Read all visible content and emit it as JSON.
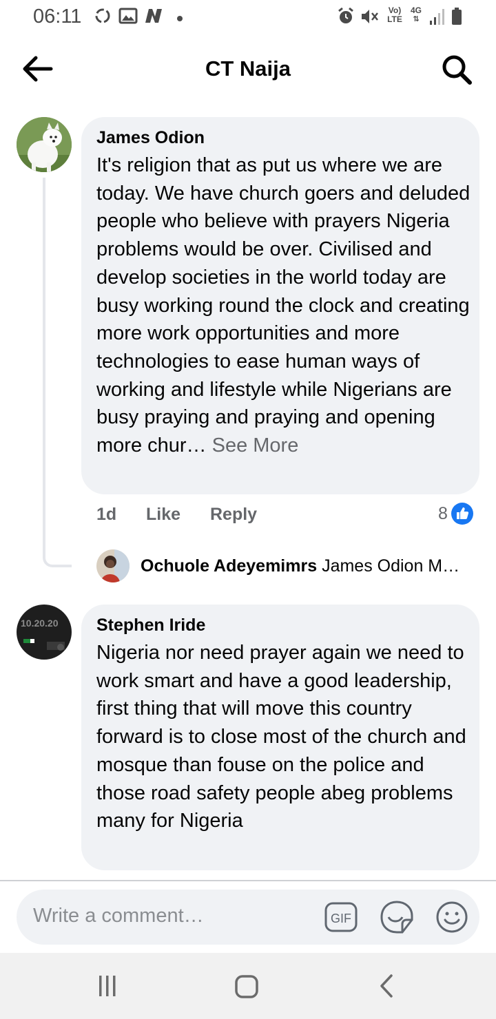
{
  "status_bar": {
    "time": "06:11",
    "left_icons": [
      "sync-icon",
      "gallery-icon",
      "n-icon",
      "dot-icon"
    ],
    "right_icons": [
      "alarm-icon",
      "mute-icon",
      "volte-icon",
      "4g-icon",
      "signal-icon",
      "battery-icon"
    ],
    "volte_top": "Vo)",
    "volte_bottom": "LTE",
    "net_label": "4G"
  },
  "header": {
    "title": "CT Naija",
    "back_icon": "arrow-left-icon",
    "search_icon": "search-icon"
  },
  "comments": [
    {
      "author": "James Odion",
      "text": "It's religion that as put us where we are today. We have church goers and deluded people who believe with prayers Nigeria problems would be over. Civilised and develop societies in the world today are busy working round the clock and creating more work opportunities and more technologies to ease human ways of working and lifestyle while Nigerians are busy praying and praying and opening  more chur…",
      "see_more": "See More",
      "time": "1d",
      "like_label": "Like",
      "reply_label": "Reply",
      "reactions_count": "8",
      "reaction_icon": "like-reaction-icon",
      "reply": {
        "author": "Ochuole Adeyemimrs",
        "snippet": "James Odion M…"
      }
    },
    {
      "author": "Stephen Iride",
      "text": "Nigeria nor need prayer again we need to work smart and have a good leadership, first thing that will move this country forward is to close most of the church and mosque than fouse on the police and those road safety people abeg problems many for Nigeria",
      "avatar_text": "10.20.20"
    }
  ],
  "composer": {
    "placeholder": "Write a comment…",
    "icons": [
      "gif-icon",
      "sticker-icon",
      "emoji-icon"
    ],
    "gif_label": "GIF"
  },
  "nav_bar": {
    "buttons": [
      "recent-apps-icon",
      "home-icon",
      "back-nav-icon"
    ]
  },
  "colors": {
    "bubble": "#f0f2f5",
    "meta_text": "#65676b",
    "like_blue": "#1877f2"
  }
}
